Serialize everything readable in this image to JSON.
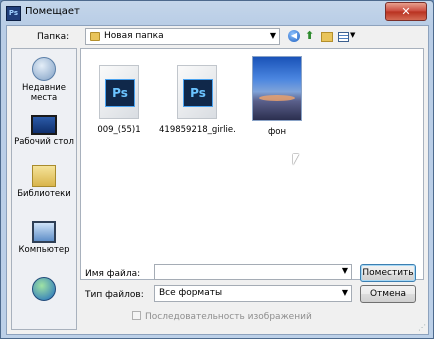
{
  "window": {
    "title": "Помещает",
    "app_icon": "Ps",
    "close_label": "✕"
  },
  "toolbar": {
    "folder_label": "Папка:",
    "folder_value": "Новая папка",
    "icons": [
      "back-icon",
      "up-folder-icon",
      "new-folder-icon",
      "view-menu-icon"
    ]
  },
  "places": [
    {
      "label": "Недавние места",
      "icon": "recent-places-icon"
    },
    {
      "label": "Рабочий стол",
      "icon": "desktop-icon"
    },
    {
      "label": "Библиотеки",
      "icon": "libraries-icon"
    },
    {
      "label": "Компьютер",
      "icon": "computer-icon"
    },
    {
      "label": "",
      "icon": "network-icon"
    }
  ],
  "files": [
    {
      "name": "009_(55)1",
      "type": "psd",
      "thumb_text": "Ps"
    },
    {
      "name": "419859218_girlie...",
      "type": "psd",
      "thumb_text": "Ps"
    },
    {
      "name": "фон",
      "type": "image"
    }
  ],
  "form": {
    "filename_label": "Имя файла:",
    "filename_value": "",
    "filetype_label": "Тип файлов:",
    "filetype_value": "Все форматы",
    "open_button": "Поместить",
    "cancel_button": "Отмена",
    "sequence_label": "Последовательность изображений",
    "sequence_checked": false
  }
}
